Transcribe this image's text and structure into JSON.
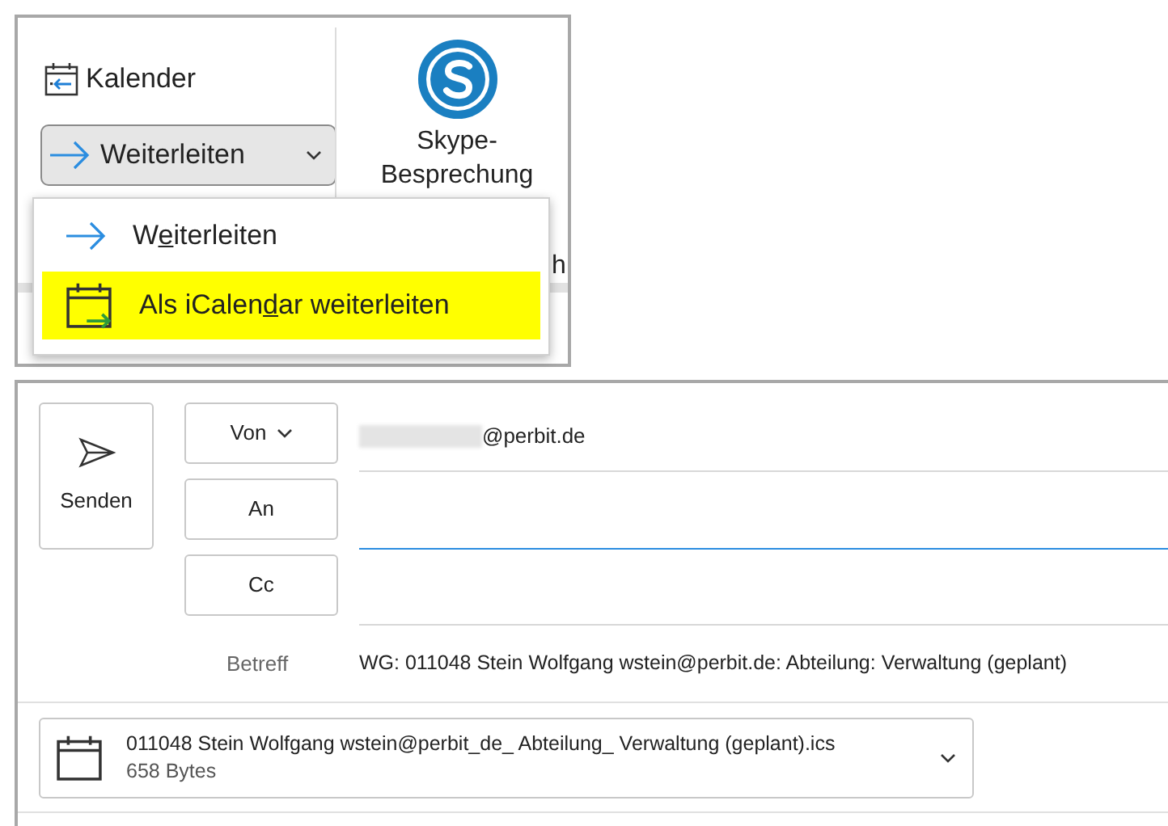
{
  "ribbon": {
    "calendar_button": {
      "label": "Kalender"
    },
    "forward_button": {
      "label": "Weiterleiten",
      "expanded": true
    },
    "skype_button": {
      "lines": [
        "Skype-",
        "Besprechung"
      ],
      "hidden_fragment": "h"
    },
    "menu": [
      {
        "kind": "forward",
        "before": "W",
        "key": "e",
        "after": "iterleiten",
        "selected": false
      },
      {
        "kind": "icalendar",
        "before": "Als iCalen",
        "key": "d",
        "after": "ar weiterleiten",
        "selected": true
      }
    ]
  },
  "compose": {
    "send_button": {
      "label": "Senden"
    },
    "from": {
      "label": "Von",
      "value": "@perbit.de"
    },
    "to": {
      "label": "An",
      "focused": true
    },
    "cc": {
      "label": "Cc",
      "focused": false
    },
    "subject": {
      "label": "Betreff",
      "value": "WG: 011048 Stein Wolfgang wstein@perbit.de: Abteilung: Verwaltung (geplant)"
    },
    "attachment": {
      "name": "011048 Stein Wolfgang wstein@perbit_de_ Abteilung_ Verwaltung (geplant).ics",
      "size": "658 Bytes"
    }
  }
}
